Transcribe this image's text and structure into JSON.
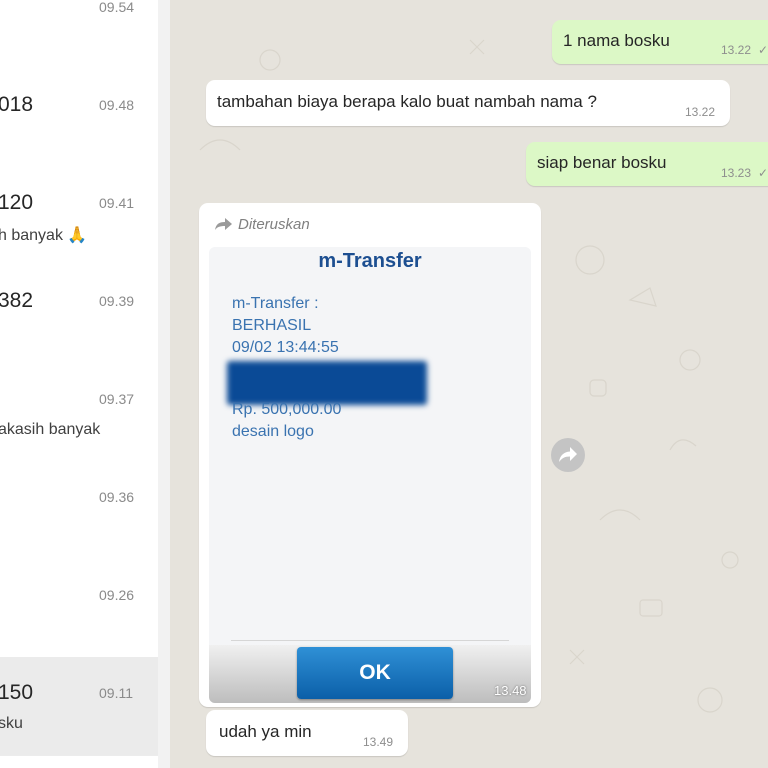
{
  "chat_list": [
    {
      "name": "",
      "time": "09.54",
      "preview": ""
    },
    {
      "name": "018",
      "time": "09.48",
      "preview": ""
    },
    {
      "name": "120",
      "time": "09.41",
      "preview": "h  banyak 🙏"
    },
    {
      "name": "382",
      "time": "09.39",
      "preview": ""
    },
    {
      "name": "",
      "time": "09.37",
      "preview": "akasih banyak"
    },
    {
      "name": "",
      "time": "09.36",
      "preview": ""
    },
    {
      "name": "",
      "time": "09.26",
      "preview": ""
    },
    {
      "name": "150",
      "time": "09.11",
      "preview": "sku"
    }
  ],
  "messages": {
    "m1": {
      "text": "1 nama bosku",
      "time": "13.22",
      "ticks": "✓✓"
    },
    "m2": {
      "text": "tambahan biaya berapa kalo buat nambah nama ?",
      "time": "13.22"
    },
    "m3": {
      "text": "siap benar bosku",
      "time": "13.23",
      "ticks": "✓✓"
    },
    "forwarded": {
      "label": "Diteruskan",
      "title": "m-Transfer",
      "lines": [
        "m-Transfer :",
        "BERHASIL",
        "09/02 13:44:55"
      ],
      "amount": "Rp. 500,000.00",
      "note": "desain logo",
      "button": "OK",
      "time": "13.48"
    },
    "m4": {
      "text": "udah ya min",
      "time": "13.49"
    }
  },
  "colors": {
    "outgoing_bubble": "#dcf8c6",
    "incoming_bubble": "#ffffff",
    "chat_background": "#e6e3dc",
    "transfer_blue": "#1d4f91",
    "ok_button": "#0b5fa8"
  },
  "icons": {
    "forward_label": "forward-arrow-icon",
    "share": "share-icon"
  }
}
